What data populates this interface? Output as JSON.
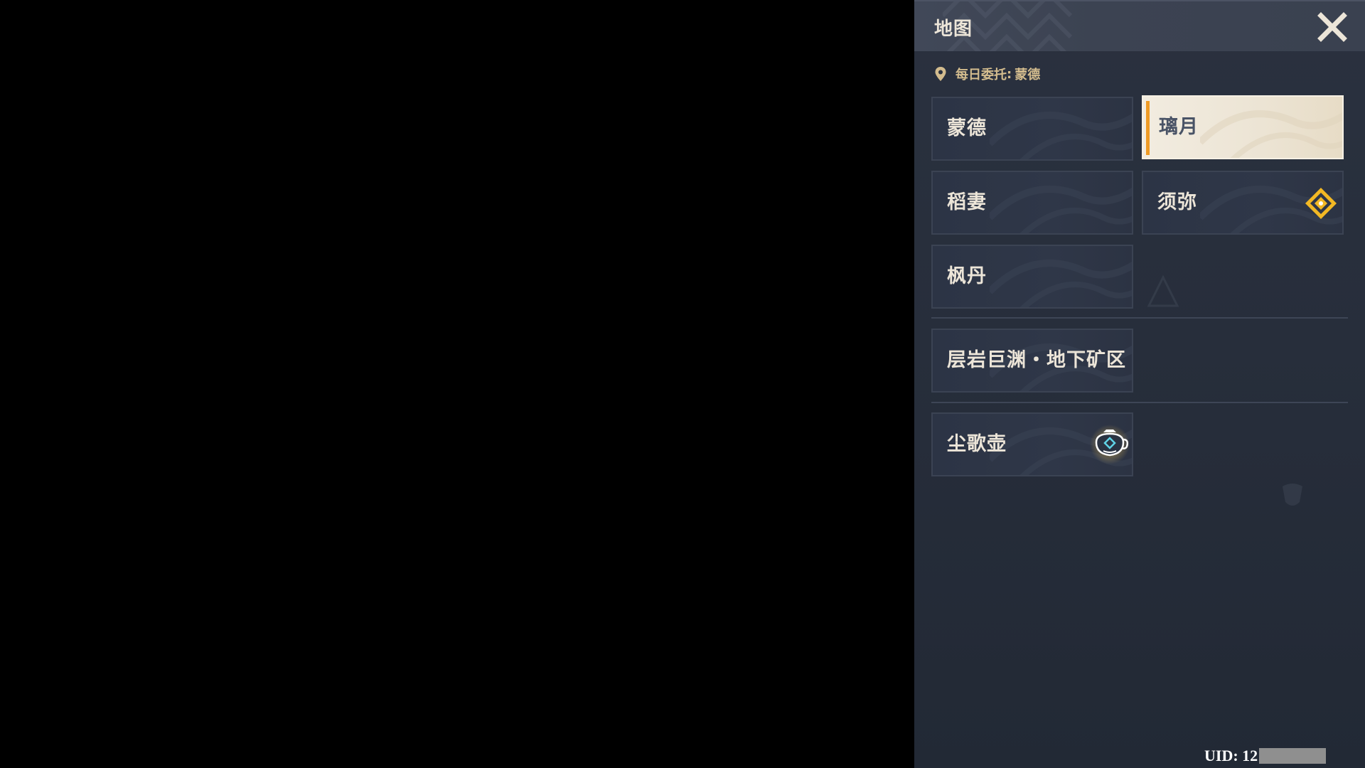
{
  "panel": {
    "title": "地图",
    "close_icon": "close-icon",
    "commission": {
      "icon": "location-pin-icon",
      "label": "每日委托",
      "separator": ":",
      "value": "蒙德"
    }
  },
  "regions": [
    {
      "label": "蒙德",
      "selected": false
    },
    {
      "label": "璃月",
      "selected": true
    },
    {
      "label": "稻妻",
      "selected": false
    },
    {
      "label": "须弥",
      "selected": false,
      "icon": "diamond-marker-icon"
    },
    {
      "label": "枫丹",
      "selected": false
    }
  ],
  "underground": {
    "label": "层岩巨渊・地下矿区"
  },
  "serenitea": {
    "label": "尘歌壶",
    "icon": "teapot-icon"
  },
  "uid": {
    "label": "UID: 12"
  },
  "colors": {
    "accent": "#ef9b25",
    "title_text": "#ece5d8",
    "commission_text": "#d3bc8e",
    "selected_bg": "#ece4d4",
    "selected_text": "#495366",
    "diamond": "#f2b824"
  }
}
